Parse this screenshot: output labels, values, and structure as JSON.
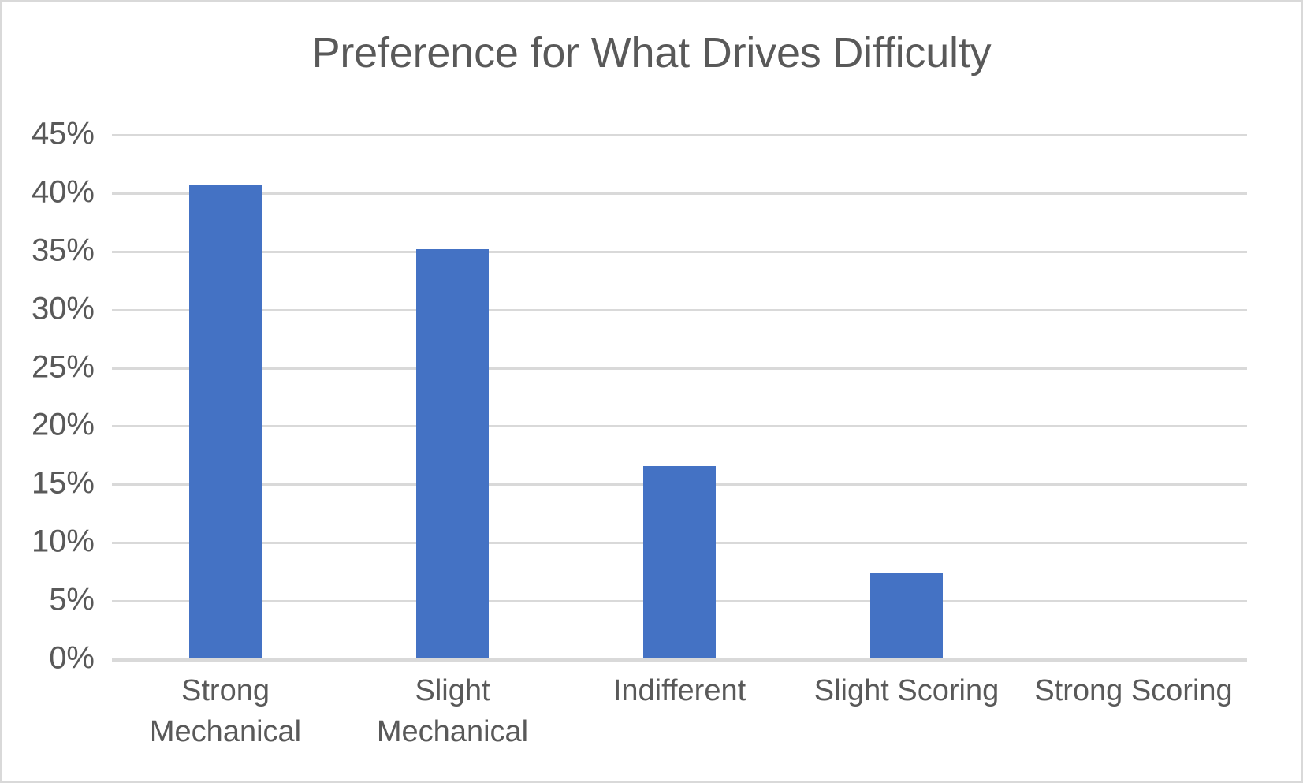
{
  "chart_data": {
    "type": "bar",
    "title": "Preference for What Drives Difficulty",
    "xlabel": "",
    "ylabel": "",
    "categories": [
      "Strong Mechanical",
      "Slight Mechanical",
      "Indifferent",
      "Slight Scoring",
      "Strong Scoring"
    ],
    "category_lines": [
      [
        "Strong",
        "Mechanical"
      ],
      [
        "Slight",
        "Mechanical"
      ],
      [
        "Indifferent",
        ""
      ],
      [
        "Slight Scoring",
        ""
      ],
      [
        "Strong Scoring",
        ""
      ]
    ],
    "values": [
      40.6,
      35.1,
      16.5,
      7.3,
      0
    ],
    "value_unit": "%",
    "ylim": [
      0,
      45
    ],
    "ytick_values": [
      45,
      40,
      35,
      30,
      25,
      20,
      15,
      10,
      5,
      0
    ],
    "ytick_labels": [
      "45%",
      "40%",
      "35%",
      "30%",
      "25%",
      "20%",
      "15%",
      "10%",
      "5%",
      "0%"
    ],
    "grid": true,
    "grid_axis": "y",
    "legend": false,
    "bar_color": "#4472C4",
    "grid_color": "#D9D9D9",
    "text_color": "#595959",
    "background_color": "#FFFFFF",
    "border_color": "#D9D9D9"
  }
}
